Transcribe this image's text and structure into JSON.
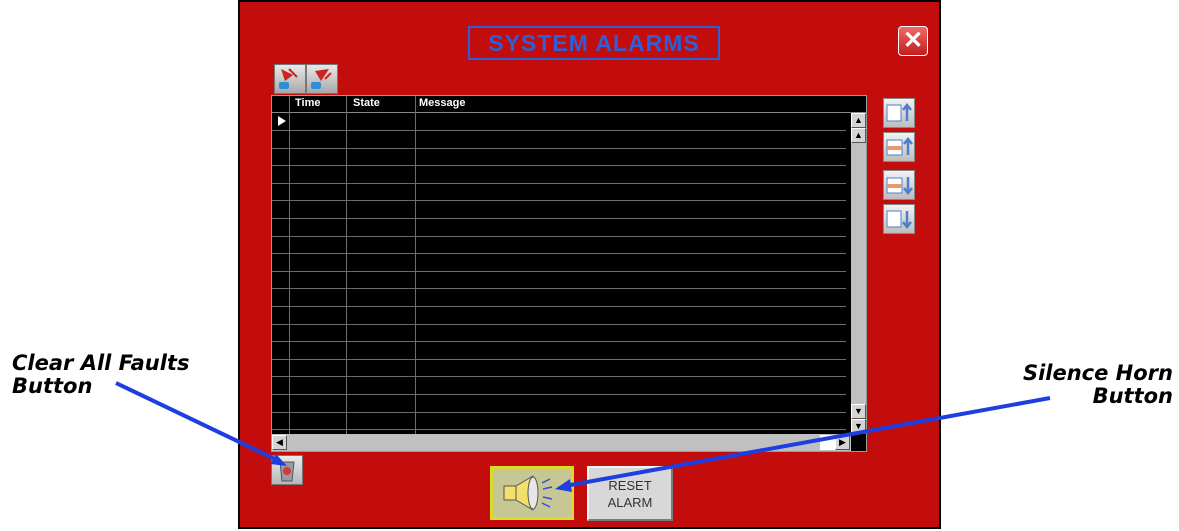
{
  "window": {
    "title": "SYSTEM ALARMS",
    "close_symbol": "✕"
  },
  "toolbar": {
    "icons": [
      "alarm-acknowledge-icon",
      "alarm-acknowledge-all-icon"
    ]
  },
  "alarm_table": {
    "columns": [
      "Time",
      "State",
      "Message"
    ],
    "rows": []
  },
  "navigation": {
    "icons": [
      "page-up-icon",
      "line-up-icon",
      "line-down-icon",
      "page-down-icon"
    ]
  },
  "buttons": {
    "reset_line1": "RESET",
    "reset_line2": "ALARM",
    "silence_icon": "speaker-icon",
    "clear_icon": "trash-icon"
  },
  "annotations": {
    "clear_all_line1": "Clear All Faults",
    "clear_all_line2": "Button",
    "silence_line1": "Silence Horn",
    "silence_line2": "Button"
  },
  "colors": {
    "panel": "#c30d0d",
    "title": "#2f5fd6",
    "arrow": "#1d3fe0"
  }
}
